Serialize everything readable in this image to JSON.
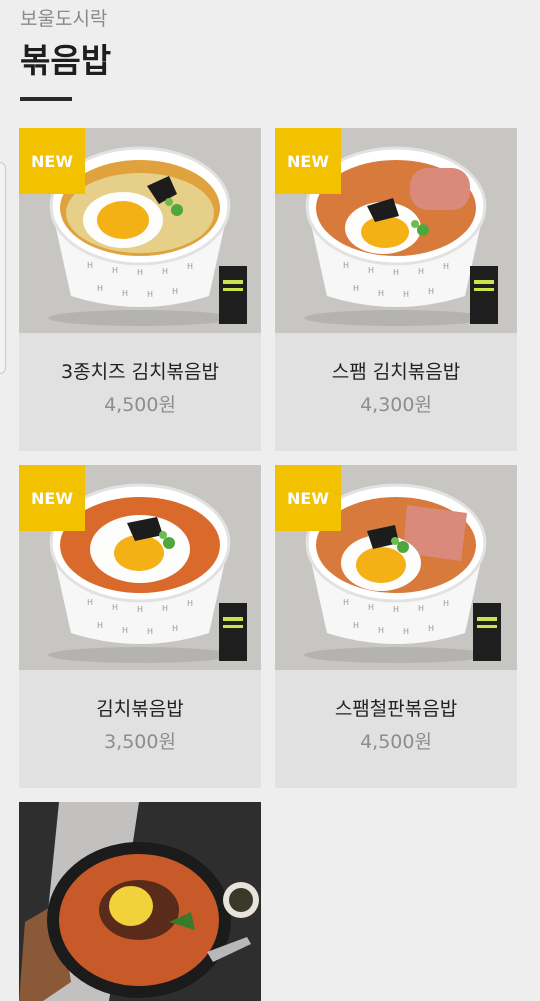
{
  "header": {
    "category": "보울도시락",
    "title": "볶음밥"
  },
  "products": [
    {
      "badge": "NEW",
      "name": "3종치즈 김치볶음밥",
      "price": "4,500원",
      "topping": "cheese"
    },
    {
      "badge": "NEW",
      "name": "스팸 김치볶음밥",
      "price": "4,300원",
      "topping": "spam"
    },
    {
      "badge": "NEW",
      "name": "김치볶음밥",
      "price": "3,500원",
      "topping": "kimchi"
    },
    {
      "badge": "NEW",
      "name": "스팸철판볶음밥",
      "price": "4,500원",
      "topping": "spam"
    }
  ],
  "icons": {
    "badge_color": "#f2c200",
    "background": "#efeeef"
  }
}
